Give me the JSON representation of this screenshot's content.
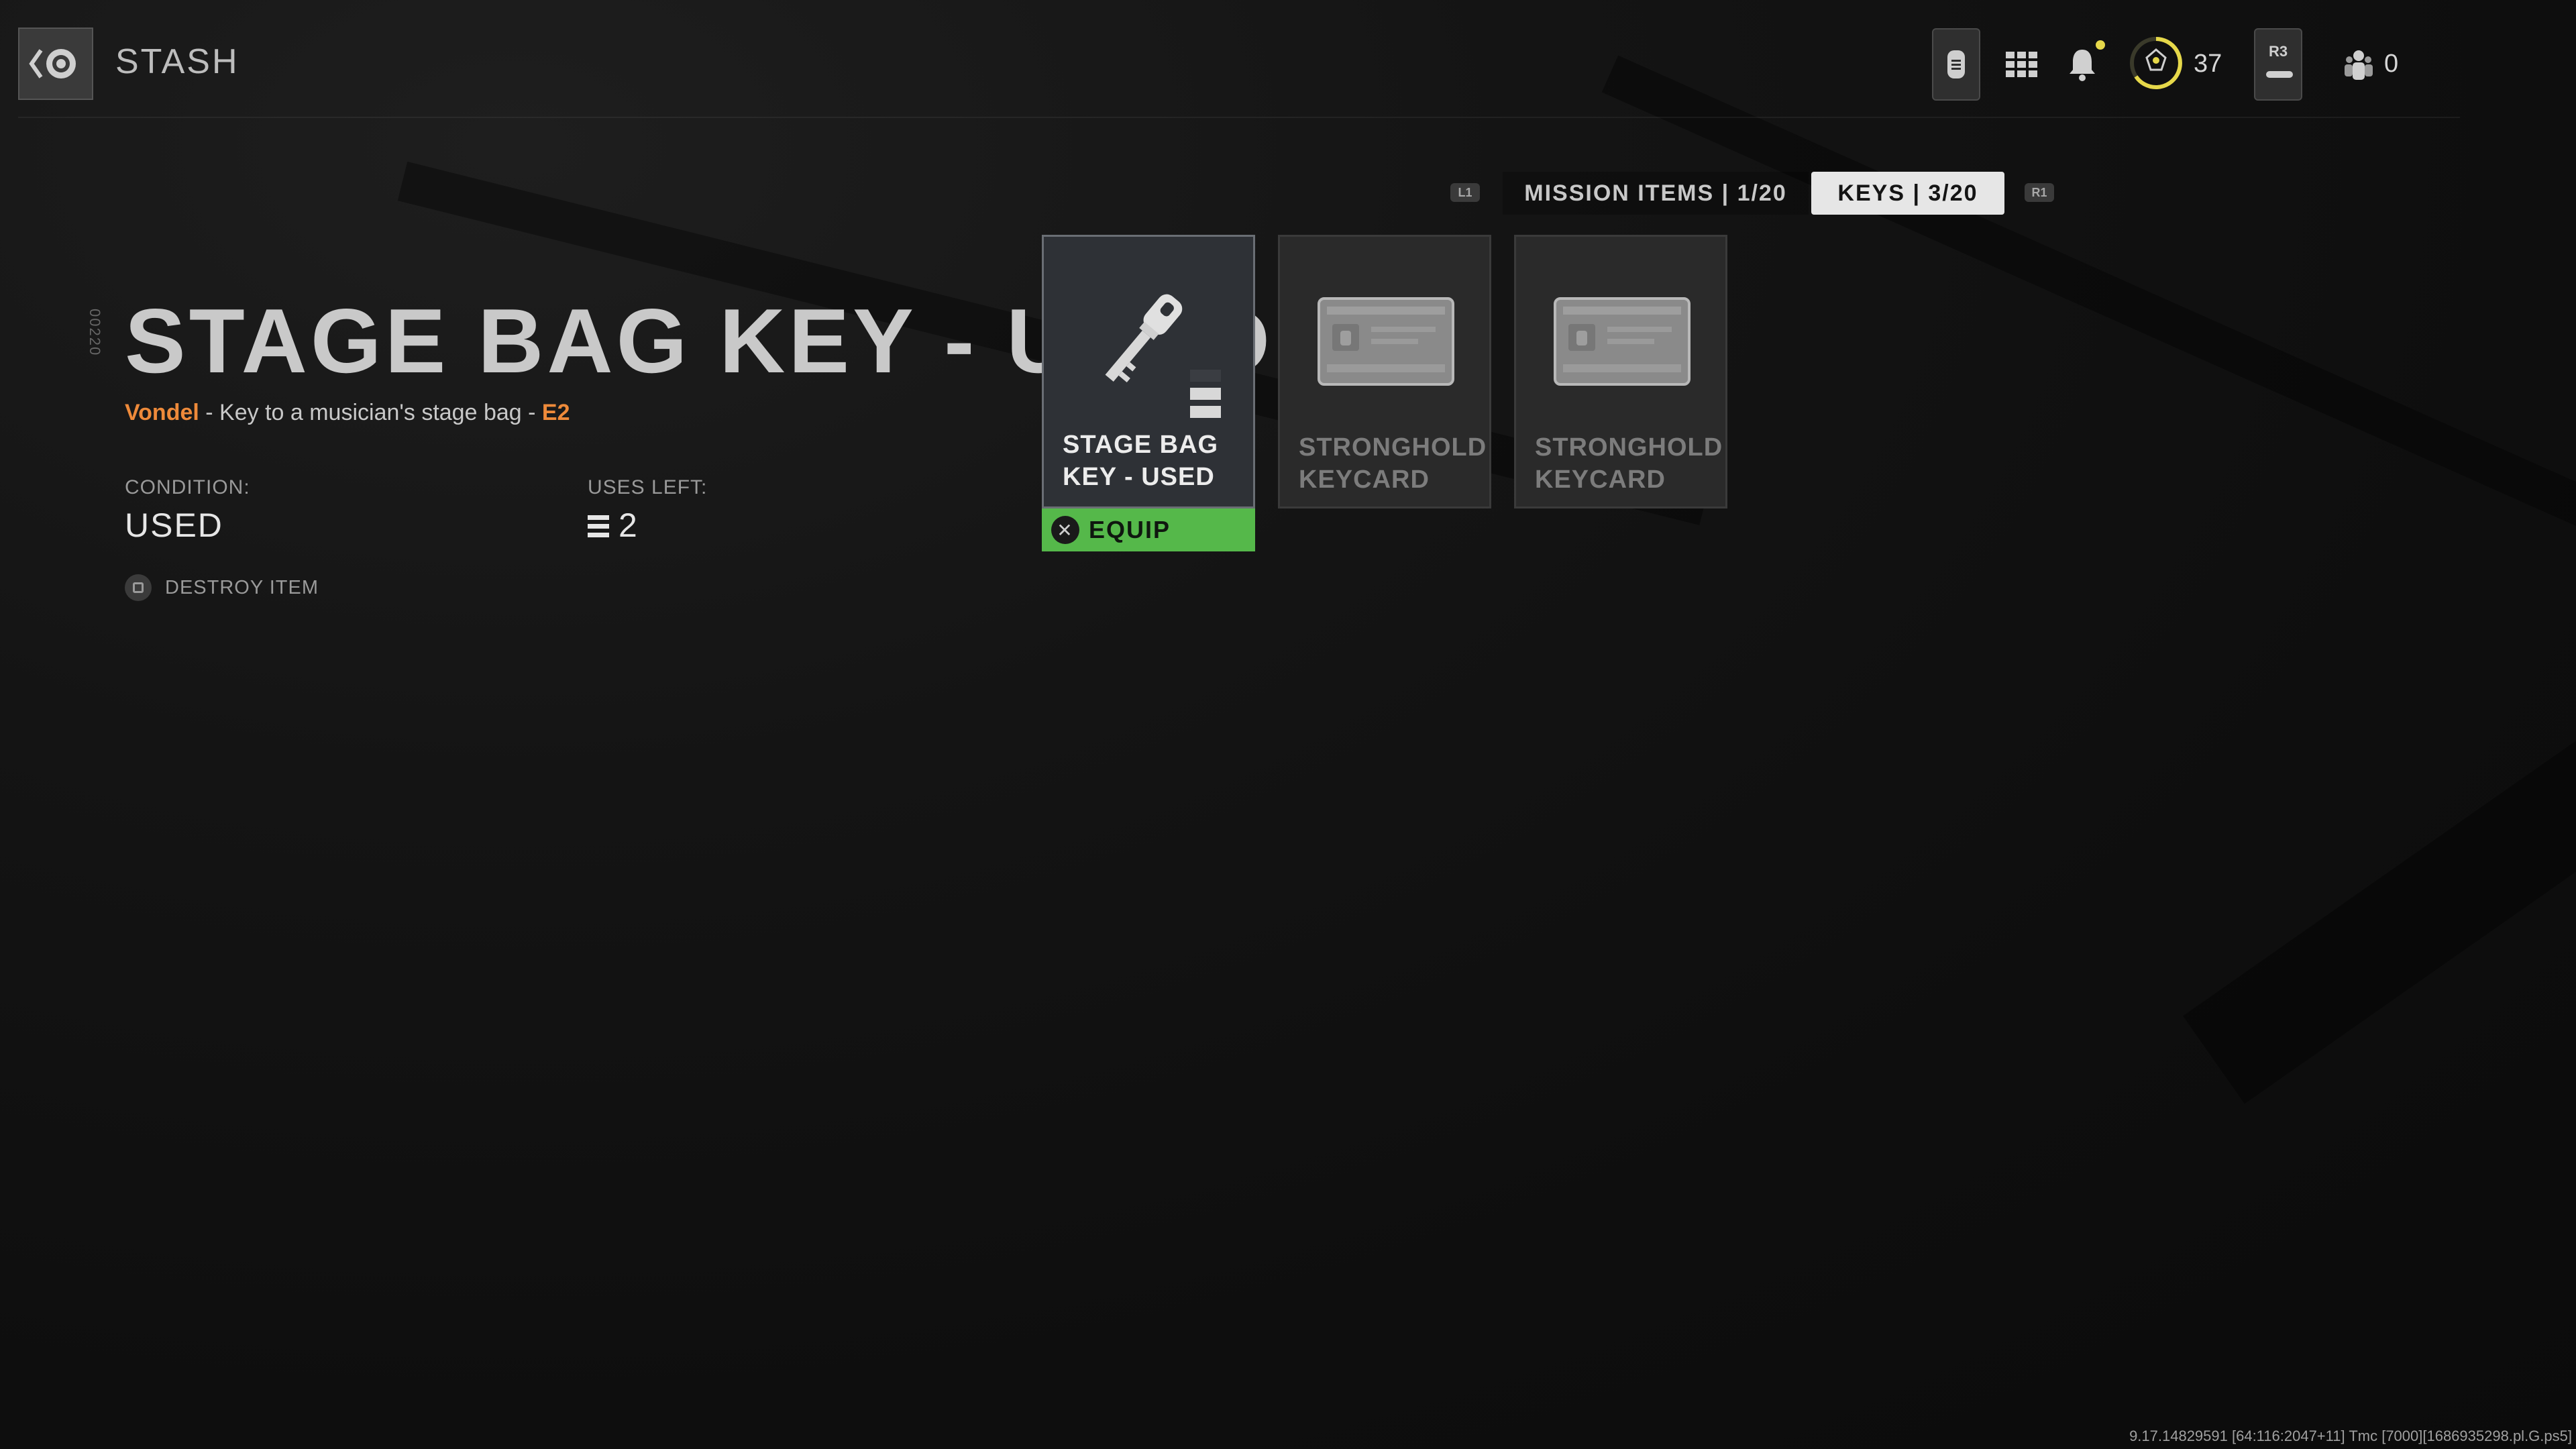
{
  "header": {
    "title": "STASH",
    "back_icon": "back-chevron-eye-icon"
  },
  "topbar": {
    "currency_count": "37",
    "r3_label": "R3",
    "squad_count": "0",
    "notification_dot_color": "#e6d84a"
  },
  "tabs": {
    "left_shoulder": "L1",
    "right_shoulder": "R1",
    "items": [
      {
        "label": "MISSION ITEMS | 1/20",
        "active": false
      },
      {
        "label": "KEYS | 3/20",
        "active": true
      }
    ]
  },
  "detail": {
    "side_code": "00220",
    "name": "STAGE BAG KEY - USED",
    "location": "Vondel",
    "description": " - Key to a musician's stage bag - ",
    "grid": "E2",
    "condition_label": "CONDITION:",
    "condition_value": "USED",
    "uses_label": "USES LEFT:",
    "uses_value": "2",
    "destroy_label": "DESTROY ITEM"
  },
  "cards": [
    {
      "name": "STAGE BAG KEY - USED",
      "icon": "key-icon",
      "selected": true
    },
    {
      "name": "STRONGHOLD KEYCARD",
      "icon": "keycard-icon",
      "selected": false
    },
    {
      "name": "STRONGHOLD KEYCARD",
      "icon": "keycard-icon",
      "selected": false
    }
  ],
  "equip_label": "EQUIP",
  "build_info": "9.17.14829591 [64:116:2047+11] Tmc [7000][1686935298.pl.G.ps5]",
  "colors": {
    "accent_orange": "#ee8a3a",
    "equip_green": "#55b84a",
    "active_tab": "#e6e6e6"
  }
}
